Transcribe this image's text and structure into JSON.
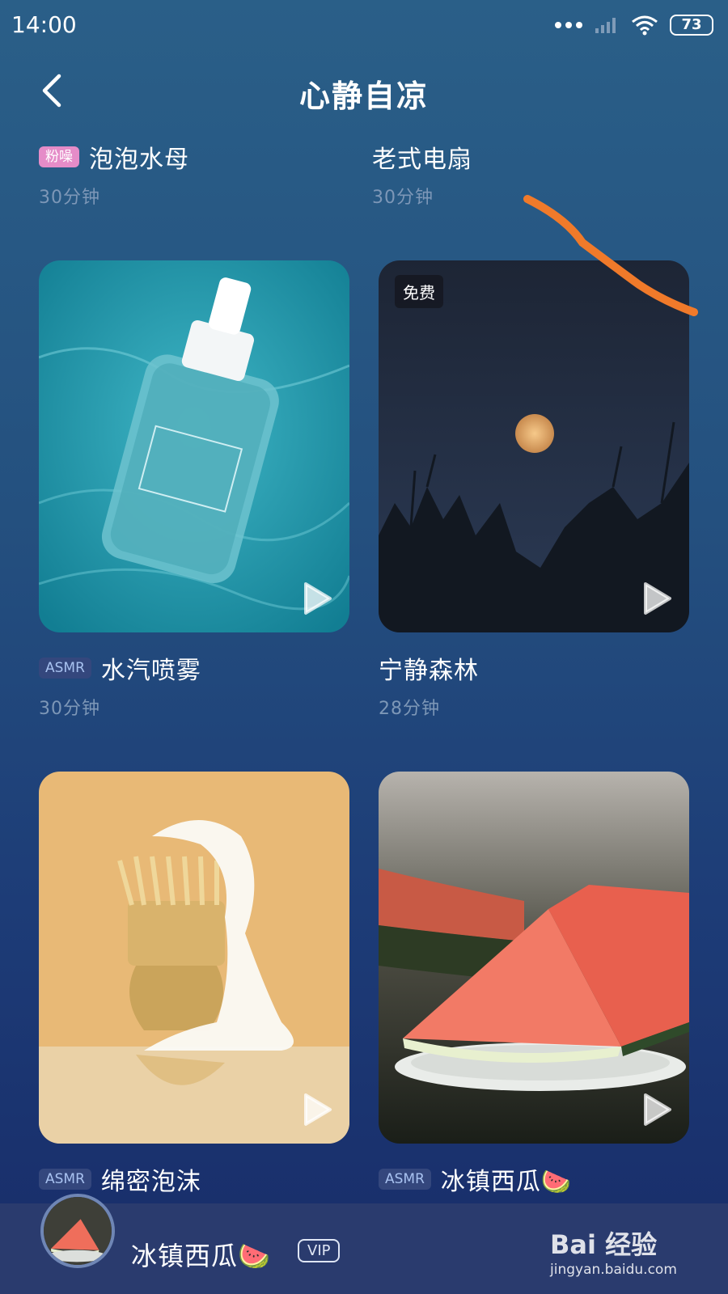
{
  "status_bar": {
    "time": "14:00",
    "battery": "73"
  },
  "header": {
    "title": "心静自凉"
  },
  "items": [
    {
      "badge": "粉噪",
      "title": "泡泡水母",
      "duration": "30分钟"
    },
    {
      "badge": "",
      "title": "老式电扇",
      "duration": "30分钟"
    },
    {
      "badge": "ASMR",
      "title": "水汽喷雾",
      "duration": "30分钟",
      "free_tag": ""
    },
    {
      "badge": "",
      "title": "宁静森林",
      "duration": "28分钟",
      "free_tag": "免费"
    },
    {
      "badge": "ASMR",
      "title": "绵密泡沫",
      "duration": ""
    },
    {
      "badge": "ASMR",
      "title": "冰镇西瓜🍉",
      "duration": ""
    }
  ],
  "player": {
    "title": "冰镇西瓜🍉",
    "badge": "VIP"
  },
  "watermark": {
    "logo": "Bai 经验",
    "url": "jingyan.baidu.com"
  },
  "colors": {
    "accent_pink": "#e58cc8",
    "annotation_orange": "#f07a2a"
  }
}
